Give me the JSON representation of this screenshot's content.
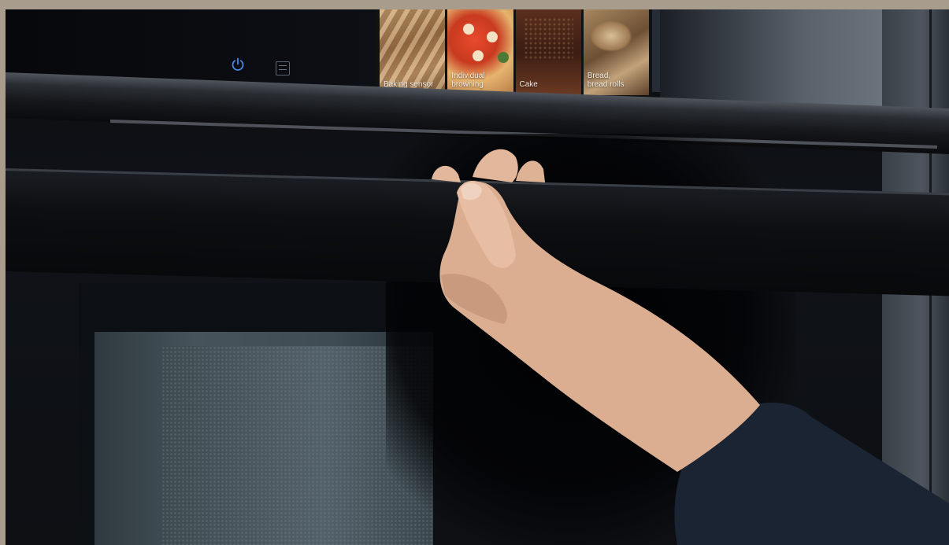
{
  "scene": {
    "description_colors": {
      "background_frame": "#a89c8d",
      "oven_body": "#0d1014",
      "skin": "#e2b79b",
      "sleeve": "#1a2433"
    }
  },
  "control_panel": {
    "icons": [
      "power-icon",
      "steam-icon"
    ]
  },
  "display": {
    "tiles": [
      {
        "label_line1": "Baking sensor",
        "label_line2": ""
      },
      {
        "label_line1": "Individual",
        "label_line2": "browning"
      },
      {
        "label_line1": "Cake",
        "label_line2": ""
      },
      {
        "label_line1": "Bread,",
        "label_line2": "bread rolls"
      }
    ]
  }
}
